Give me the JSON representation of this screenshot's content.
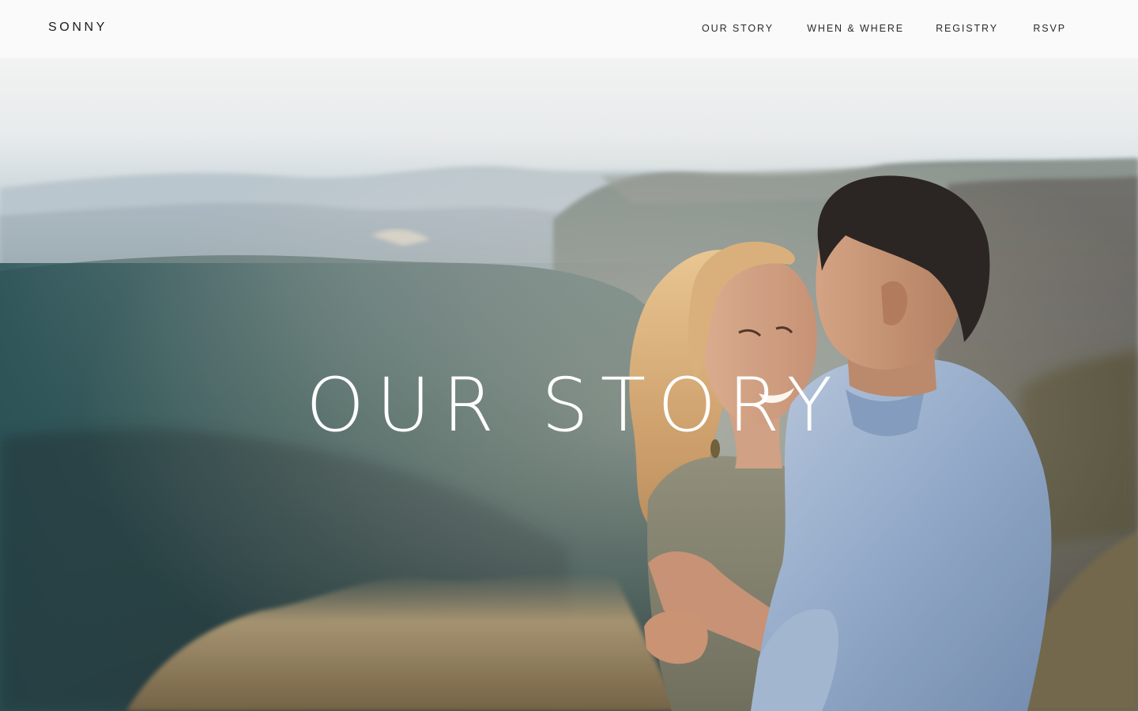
{
  "brand": {
    "name": "SONNY"
  },
  "nav": {
    "items": [
      {
        "label": "OUR STORY"
      },
      {
        "label": "WHEN & WHERE"
      },
      {
        "label": "REGISTRY"
      },
      {
        "label": "RSVP"
      }
    ]
  },
  "hero": {
    "title": "OUR STORY"
  },
  "colors": {
    "header_bg": "#fafafa",
    "text": "#1c1c1c",
    "hero_text": "#ffffff"
  }
}
